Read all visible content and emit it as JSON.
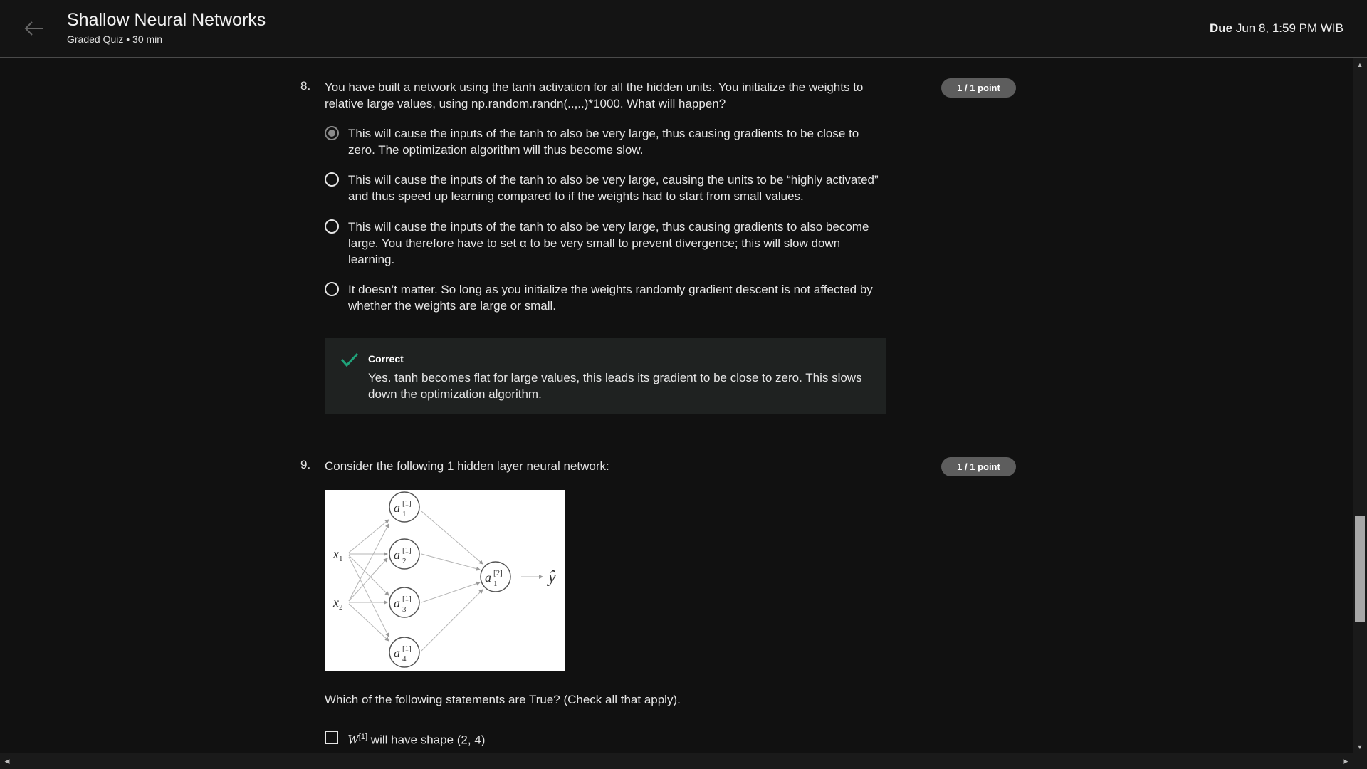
{
  "header": {
    "title": "Shallow Neural Networks",
    "subtitle": "Graded Quiz • 30 min",
    "due_label": "Due",
    "due_value": "Jun 8, 1:59 PM WIB"
  },
  "question8": {
    "number": "8.",
    "text": "You have built a network using the tanh activation for all the hidden units. You initialize the weights to relative large values, using np.random.randn(..,..)*1000. What will happen?",
    "points": "1 / 1 point",
    "options": [
      {
        "text": "This will cause the inputs of the tanh to also be very large, thus causing gradients to be close to zero. The optimization algorithm will thus become slow.",
        "selected": true
      },
      {
        "text": "This will cause the inputs of the tanh to also be very large, causing the units to be “highly activated” and thus speed up learning compared to if the weights had to start from small values.",
        "selected": false
      },
      {
        "text": "This will cause the inputs of the tanh to also be very large, thus causing gradients to also become large. You therefore have to set α to be very small to prevent divergence; this will slow down learning.",
        "selected": false
      },
      {
        "text": "It doesn’t matter. So long as you initialize the weights randomly gradient descent is not affected by whether the weights are large or small.",
        "selected": false
      }
    ],
    "feedback": {
      "title": "Correct",
      "text": "Yes. tanh becomes flat for large values, this leads its gradient to be close to zero. This slows down the optimization algorithm."
    }
  },
  "question9": {
    "number": "9.",
    "text": "Consider the following 1 hidden layer neural network:",
    "points": "1 / 1 point",
    "diagram": {
      "inputs": [
        "x",
        "x"
      ],
      "input_subscripts": [
        "1",
        "2"
      ],
      "hidden": [
        "a",
        "a",
        "a",
        "a"
      ],
      "hidden_superscript": "[1]",
      "hidden_subscripts": [
        "1",
        "2",
        "3",
        "4"
      ],
      "output": "a",
      "output_superscript": "[2]",
      "output_subscript": "1",
      "prediction": "ŷ"
    },
    "prompt": "Which of the following statements are True? (Check all that apply).",
    "options": [
      {
        "symbol": "W",
        "superscript": "[1]",
        "text": "will have shape (2, 4)"
      }
    ]
  },
  "colors": {
    "background": "#111111",
    "header_bg": "#141414",
    "badge_bg": "#5d5d5d",
    "correct_green": "#1fa37a",
    "feedback_bg": "#1f2221"
  }
}
